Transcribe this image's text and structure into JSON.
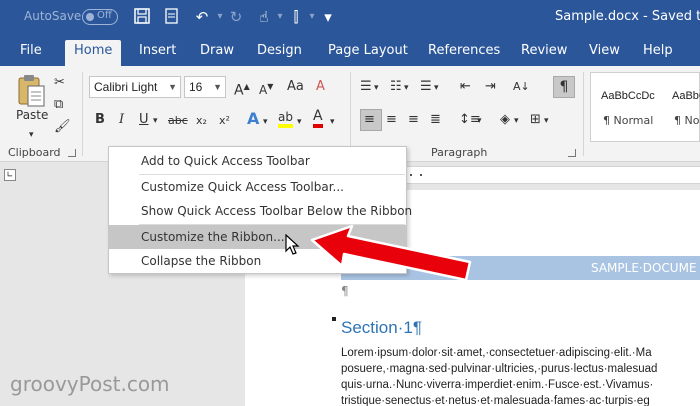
{
  "titlebar": {
    "autosave_label": "AutoSave",
    "autosave_state": "Off",
    "document_title": "Sample.docx - Saved to"
  },
  "tabs": [
    {
      "label": "File"
    },
    {
      "label": "Home",
      "active": true
    },
    {
      "label": "Insert"
    },
    {
      "label": "Draw"
    },
    {
      "label": "Design"
    },
    {
      "label": "Page Layout"
    },
    {
      "label": "References"
    },
    {
      "label": "Review"
    },
    {
      "label": "View"
    },
    {
      "label": "Help"
    }
  ],
  "ribbon": {
    "paste_label": "Paste",
    "clipboard_label": "Clipboard",
    "font_name": "Calibri Light",
    "font_size": "16",
    "bold": "B",
    "italic": "I",
    "underline": "U",
    "strikethrough": "abc",
    "subscript": "x₂",
    "superscript": "x²",
    "text_effects": "A",
    "highlight": "ab",
    "font_color": "A",
    "paragraph_label": "Paragraph",
    "pilcrow": "¶",
    "styles": [
      {
        "sample": "AaBbCcDc",
        "name": "¶ Normal"
      },
      {
        "sample": "AaBbCcDc",
        "name": "¶ No"
      }
    ]
  },
  "context_menu": {
    "items": [
      {
        "label": "Add to Quick Access Toolbar",
        "highlighted": false
      },
      {
        "label": "Customize Quick Access Toolbar...",
        "highlighted": false
      },
      {
        "label": "Show Quick Access Toolbar Below the Ribbon",
        "highlighted": false
      },
      {
        "label": "Customize the Ribbon...",
        "highlighted": true
      },
      {
        "label": "Collapse the Ribbon",
        "highlighted": false
      }
    ]
  },
  "document": {
    "header_text": "SAMPLE·DOCUME",
    "para_mark": "¶",
    "section_title": "Section·1¶",
    "body_lines": [
      "Lorem·ipsum·dolor·sit·amet,·consectetuer·adipiscing·elit.·Ma",
      "posuere,·magna·sed·pulvinar·ultricies,·purus·lectus·malesuad",
      "quis·urna.·Nunc·viverra·imperdiet·enim.·Fusce·est.·Vivamus·",
      "tristique·senectus·et·netus·et·malesuada·fames·ac·turpis·eg"
    ]
  },
  "watermark": "groovyPost.com",
  "colors": {
    "brand_blue": "#2b579a",
    "arrow_red": "#e8000b",
    "menu_highlight": "#c6c6c6",
    "header_band": "#a9c4e3",
    "section_blue": "#2e74b5"
  }
}
